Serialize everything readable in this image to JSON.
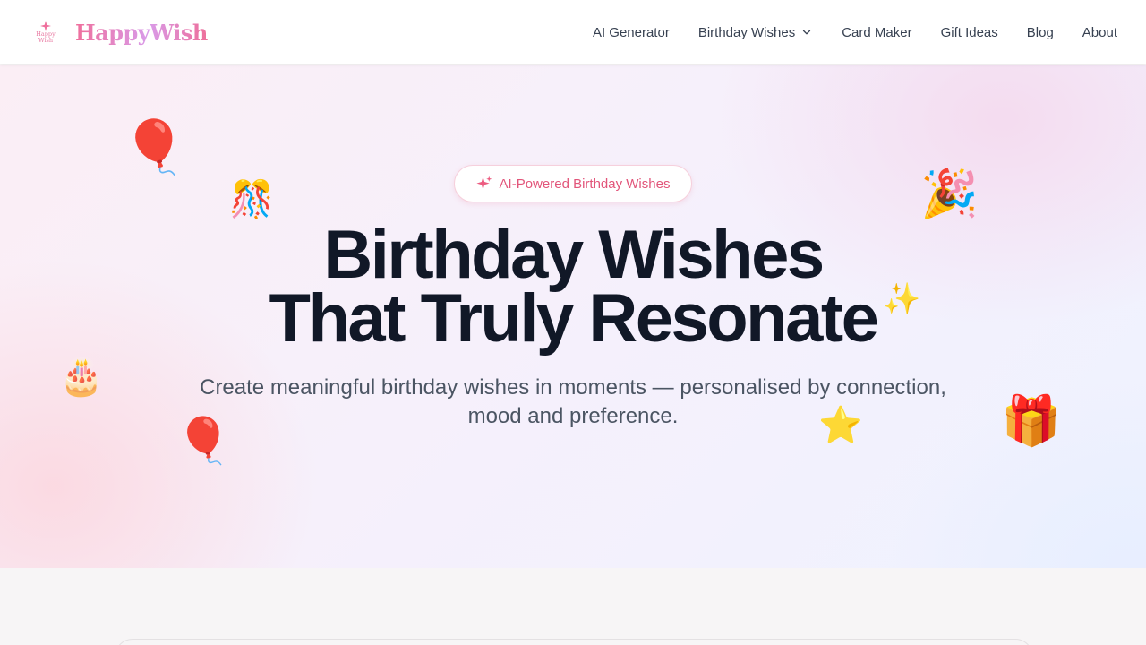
{
  "brand": {
    "name": "HappyWish",
    "mark_text_line1": "Happy",
    "mark_text_line2": "Wish",
    "colors": {
      "pink": "#ef6f9c",
      "lavender": "#d99be9",
      "accent": "#e2557a"
    }
  },
  "nav": {
    "items": [
      {
        "label": "AI Generator"
      },
      {
        "label": "Birthday Wishes",
        "has_dropdown": true,
        "icon": "chevron-down-icon"
      },
      {
        "label": "Card Maker"
      },
      {
        "label": "Gift Ideas"
      },
      {
        "label": "Blog"
      },
      {
        "label": "About"
      }
    ]
  },
  "hero": {
    "badge": {
      "label": "AI-Powered Birthday Wishes",
      "icon": "sparkle-icon"
    },
    "headline_line1": "Birthday Wishes",
    "headline_line2": "That Truly Resonate",
    "subtitle_line1": "Create meaningful birthday wishes in moments — personalised by connection,",
    "subtitle_line2": "mood and preference.",
    "decorations": [
      {
        "name": "balloon-icon",
        "glyph": "🎈"
      },
      {
        "name": "confetti-ball-icon",
        "glyph": "🎊"
      },
      {
        "name": "party-popper-icon",
        "glyph": "🎉"
      },
      {
        "name": "sparkles-icon",
        "glyph": "✨"
      },
      {
        "name": "birthday-cake-icon",
        "glyph": "🎂"
      },
      {
        "name": "balloon-icon",
        "glyph": "🎈"
      },
      {
        "name": "star-icon",
        "glyph": "⭐"
      },
      {
        "name": "gift-icon",
        "glyph": "🎁"
      }
    ]
  }
}
